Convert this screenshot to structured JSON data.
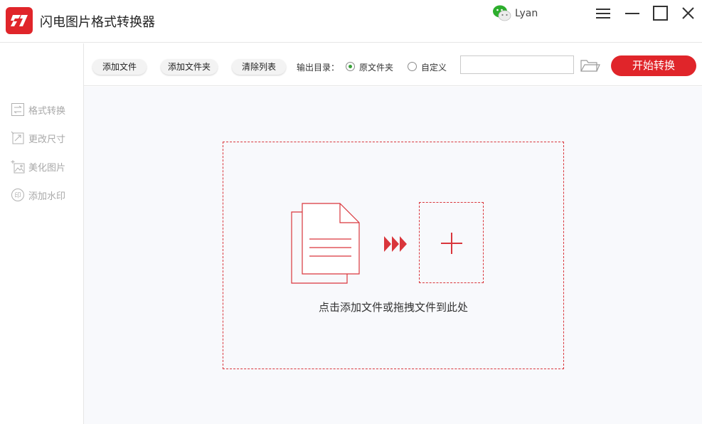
{
  "app": {
    "title": "闪电图片格式转换器",
    "logo_icon": "lightning-logo-icon",
    "brand_color": "#e0252a"
  },
  "user": {
    "name": "Lyan",
    "avatar_icon": "wechat-icon"
  },
  "window_controls": {
    "menu_icon": "hamburger-menu-icon",
    "minimize_icon": "minimize-icon",
    "maximize_icon": "maximize-icon",
    "close_icon": "close-icon"
  },
  "sidebar": {
    "items": [
      {
        "label": "格式转换",
        "icon": "format-convert-icon"
      },
      {
        "label": "更改尺寸",
        "icon": "resize-icon"
      },
      {
        "label": "美化图片",
        "icon": "beautify-image-icon"
      },
      {
        "label": "添加水印",
        "icon": "watermark-stamp-icon"
      }
    ]
  },
  "toolbar": {
    "add_file": "添加文件",
    "add_folder": "添加文件夹",
    "clear_list": "清除列表",
    "output_label": "输出目录：",
    "option_original": "原文件夹",
    "option_custom": "自定义",
    "selected_option": "原文件夹",
    "path_value": "",
    "folder_icon": "open-folder-icon",
    "start_button": "开始转换"
  },
  "drop_zone": {
    "hint": "点击添加文件或拖拽文件到此处",
    "document_icon": "documents-icon",
    "arrow_icon": "triple-arrow-icon",
    "add_icon": "plus-icon"
  }
}
